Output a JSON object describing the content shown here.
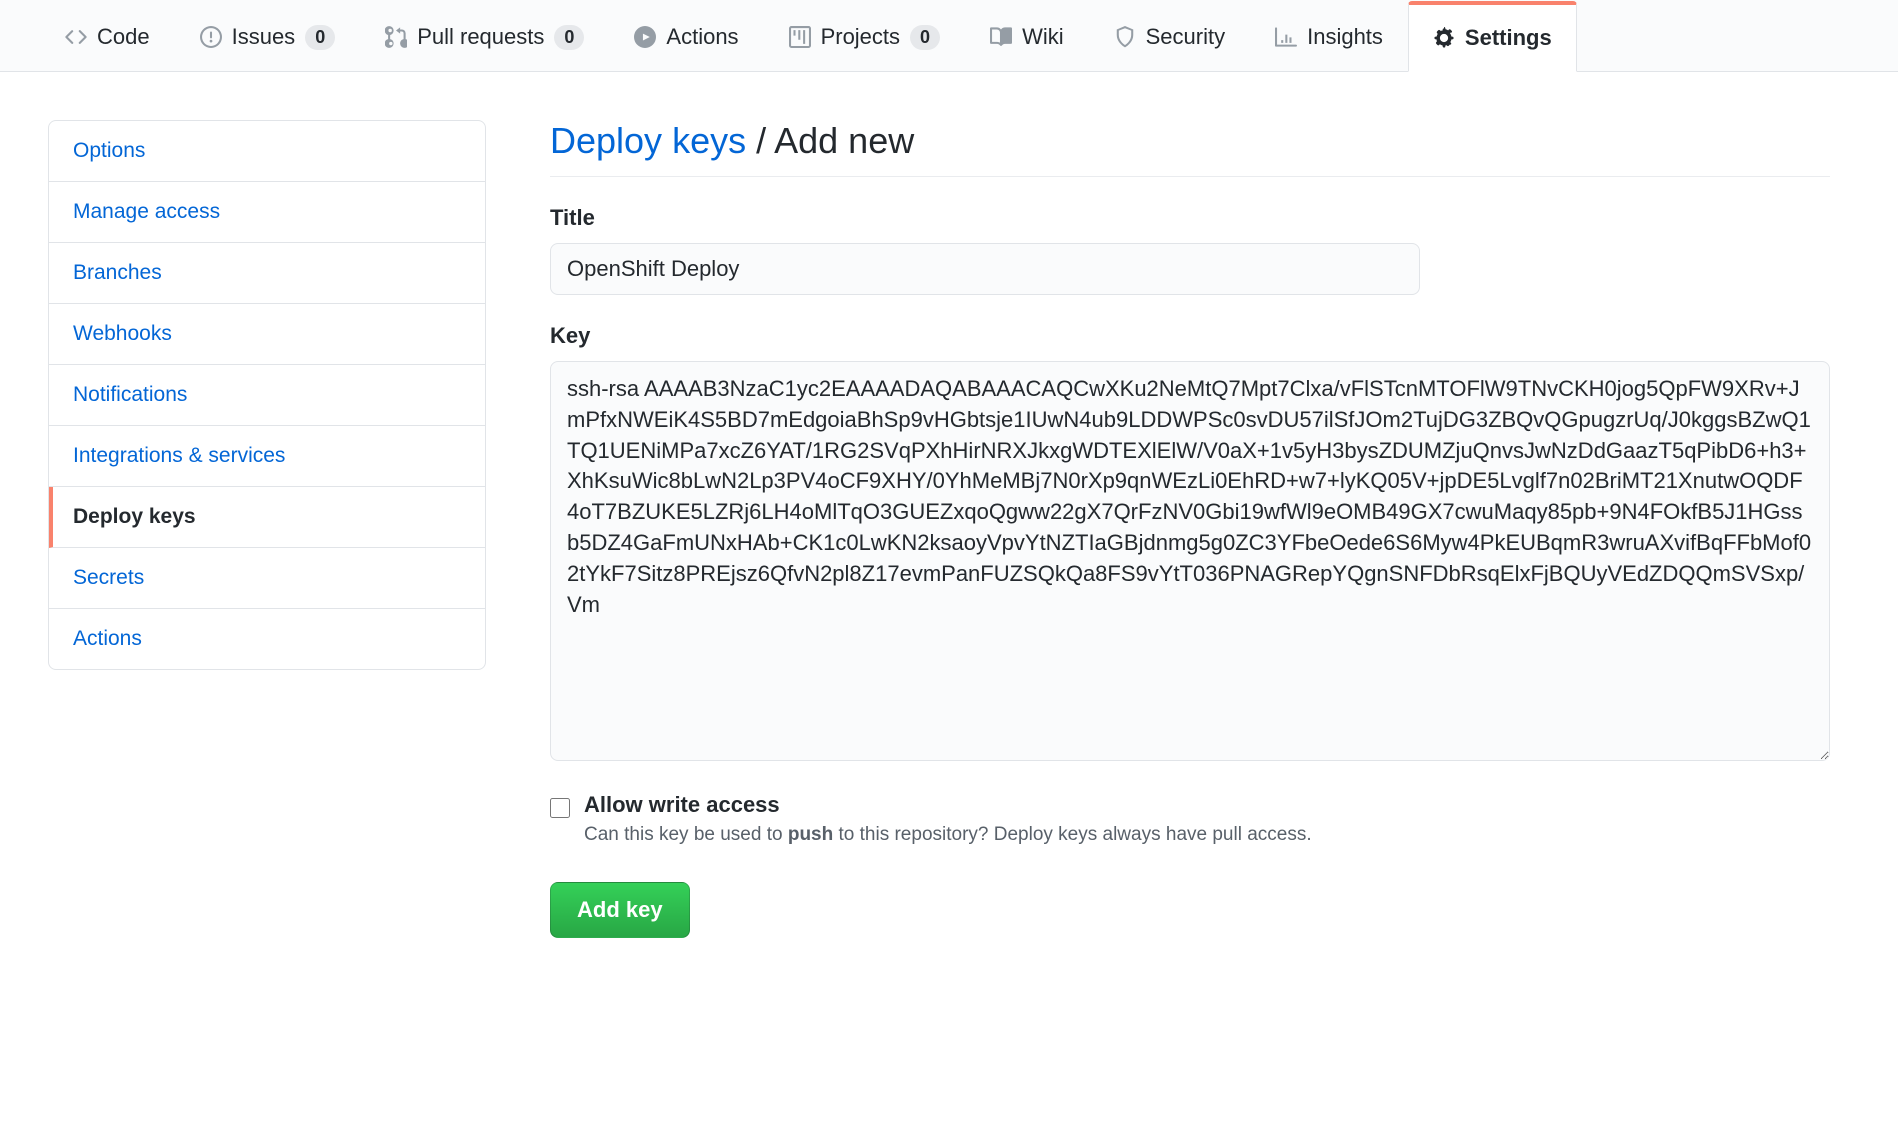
{
  "nav": {
    "tabs": [
      {
        "label": "Code",
        "count": null
      },
      {
        "label": "Issues",
        "count": "0"
      },
      {
        "label": "Pull requests",
        "count": "0"
      },
      {
        "label": "Actions",
        "count": null
      },
      {
        "label": "Projects",
        "count": "0"
      },
      {
        "label": "Wiki",
        "count": null
      },
      {
        "label": "Security",
        "count": null
      },
      {
        "label": "Insights",
        "count": null
      },
      {
        "label": "Settings",
        "count": null
      }
    ]
  },
  "sidebar": {
    "items": [
      "Options",
      "Manage access",
      "Branches",
      "Webhooks",
      "Notifications",
      "Integrations & services",
      "Deploy keys",
      "Secrets",
      "Actions"
    ],
    "active_index": 6
  },
  "page": {
    "breadcrumb_link": "Deploy keys",
    "breadcrumb_sep": " / ",
    "breadcrumb_current": "Add new"
  },
  "form": {
    "title_label": "Title",
    "title_value": "OpenShift Deploy",
    "key_label": "Key",
    "key_value": "ssh-rsa AAAAB3NzaC1yc2EAAAADAQABAAACAQCwXKu2NeMtQ7Mpt7Clxa/vFlSTcnMTOFlW9TNvCKH0jog5QpFW9XRv+JmPfxNWEiK4S5BD7mEdgoiaBhSp9vHGbtsje1IUwN4ub9LDDWPSc0svDU57ilSfJOm2TujDG3ZBQvQGpugzrUq/J0kggsBZwQ1TQ1UENiMPa7xcZ6YAT/1RG2SVqPXhHirNRXJkxgWDTEXlElW/V0aX+1v5yH3bysZDUMZjuQnvsJwNzDdGaazT5qPibD6+h3+XhKsuWic8bLwN2Lp3PV4oCF9XHY/0YhMeMBj7N0rXp9qnWEzLi0EhRD+w7+lyKQ05V+jpDE5Lvglf7n02BriMT21XnutwOQDF4oT7BZUKE5LZRj6LH4oMlTqO3GUEZxqoQgww22gX7QrFzNV0Gbi19wfWl9eOMB49GX7cwuMaqy85pb+9N4FOkfB5J1HGssb5DZ4GaFmUNxHAb+CK1c0LwKN2ksaoyVpvYtNZTIaGBjdnmg5g0ZC3YFbeOede6S6Myw4PkEUBqmR3wruAXvifBqFFbMof02tYkF7Sitz8PREjsz6QfvN2pl8Z17evmPanFUZSQkQa8FS9vYtT036PNAGRepYQgnSNFDbRsqElxFjBQUyVEdZDQQmSVSxp/Vm",
    "allow_write_label": "Allow write access",
    "allow_write_note_1": "Can this key be used to ",
    "allow_write_note_strong": "push",
    "allow_write_note_2": " to this repository? Deploy keys always have pull access.",
    "submit_label": "Add key"
  }
}
